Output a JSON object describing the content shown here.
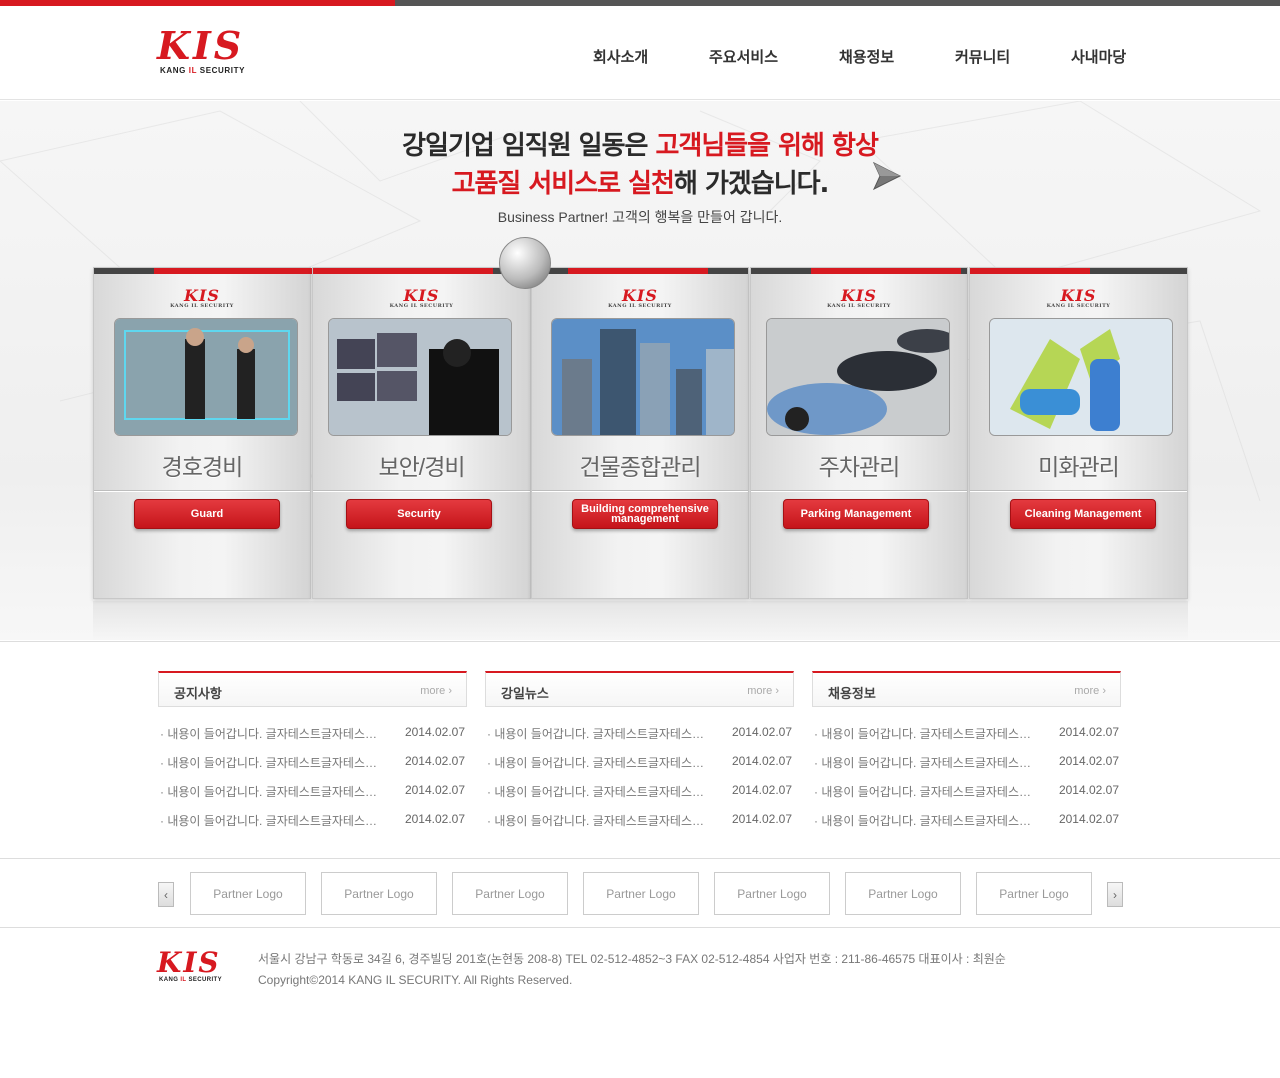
{
  "brand": {
    "logo_text": "KIS",
    "logo_sub": "KANG IL SECURITY",
    "accent": "#d71920"
  },
  "nav": {
    "items": [
      "회사소개",
      "주요서비스",
      "채용정보",
      "커뮤니티",
      "사내마당"
    ]
  },
  "hero": {
    "line1_black": "강일기업 임직원 일동은 ",
    "line1_red": "고객님들을 위해 항상",
    "line2_red": "고품질 서비스로 실천",
    "line2_black": "해 가겠습니다.",
    "tagline": "Business Partner! 고객의 행복을 만들어 갑니다.",
    "next_icon": "arrow-right-icon"
  },
  "services": [
    {
      "title": "경호경비",
      "button": "Guard",
      "photo": "bodyguards-photo"
    },
    {
      "title": "보안/경비",
      "button": "Security",
      "photo": "cctv-monitoring-photo"
    },
    {
      "title": "건물종합관리",
      "button": "Building comprehensive management",
      "photo": "buildings-photo"
    },
    {
      "title": "주차관리",
      "button": "Parking Management",
      "photo": "parked-cars-photo"
    },
    {
      "title": "미화관리",
      "button": "Cleaning Management",
      "photo": "cleaning-supplies-photo"
    }
  ],
  "boards": [
    {
      "title": "공지사항",
      "more": "more ›",
      "items": [
        {
          "text": "· 내용이 들어갑니다. 글자테스트글자테스트글자테스트",
          "date": "2014.02.07"
        },
        {
          "text": "· 내용이 들어갑니다. 글자테스트글자테스트글자테스트",
          "date": "2014.02.07"
        },
        {
          "text": "· 내용이 들어갑니다. 글자테스트글자테스트글자테스트",
          "date": "2014.02.07"
        },
        {
          "text": "· 내용이 들어갑니다. 글자테스트글자테스트글자테스트",
          "date": "2014.02.07"
        }
      ]
    },
    {
      "title": "강일뉴스",
      "more": "more ›",
      "items": [
        {
          "text": "· 내용이 들어갑니다. 글자테스트글자테스트글자테스트",
          "date": "2014.02.07"
        },
        {
          "text": "· 내용이 들어갑니다. 글자테스트글자테스트글자테스트",
          "date": "2014.02.07"
        },
        {
          "text": "· 내용이 들어갑니다. 글자테스트글자테스트글자테스트",
          "date": "2014.02.07"
        },
        {
          "text": "· 내용이 들어갑니다. 글자테스트글자테스트글자테스트",
          "date": "2014.02.07"
        }
      ]
    },
    {
      "title": "채용정보",
      "more": "more ›",
      "items": [
        {
          "text": "· 내용이 들어갑니다. 글자테스트글자테스트글자테스트",
          "date": "2014.02.07"
        },
        {
          "text": "· 내용이 들어갑니다. 글자테스트글자테스트글자테스트",
          "date": "2014.02.07"
        },
        {
          "text": "· 내용이 들어갑니다. 글자테스트글자테스트글자테스트",
          "date": "2014.02.07"
        },
        {
          "text": "· 내용이 들어갑니다. 글자테스트글자테스트글자테스트",
          "date": "2014.02.07"
        }
      ]
    }
  ],
  "partners": {
    "prev": "‹",
    "next": "›",
    "logos": [
      "Partner Logo",
      "Partner Logo",
      "Partner Logo",
      "Partner Logo",
      "Partner Logo",
      "Partner Logo",
      "Partner Logo"
    ]
  },
  "footer": {
    "address": "서울시 강남구 학동로 34길 6, 경주빌딩 201호(논현동 208-8) TEL 02-512-4852~3 FAX 02-512-4854 사업자 번호 : 211-86-46575 대표이사 : 최원순",
    "copyright": "Copyright©2014 KANG IL SECURITY. All Rights Reserved."
  }
}
